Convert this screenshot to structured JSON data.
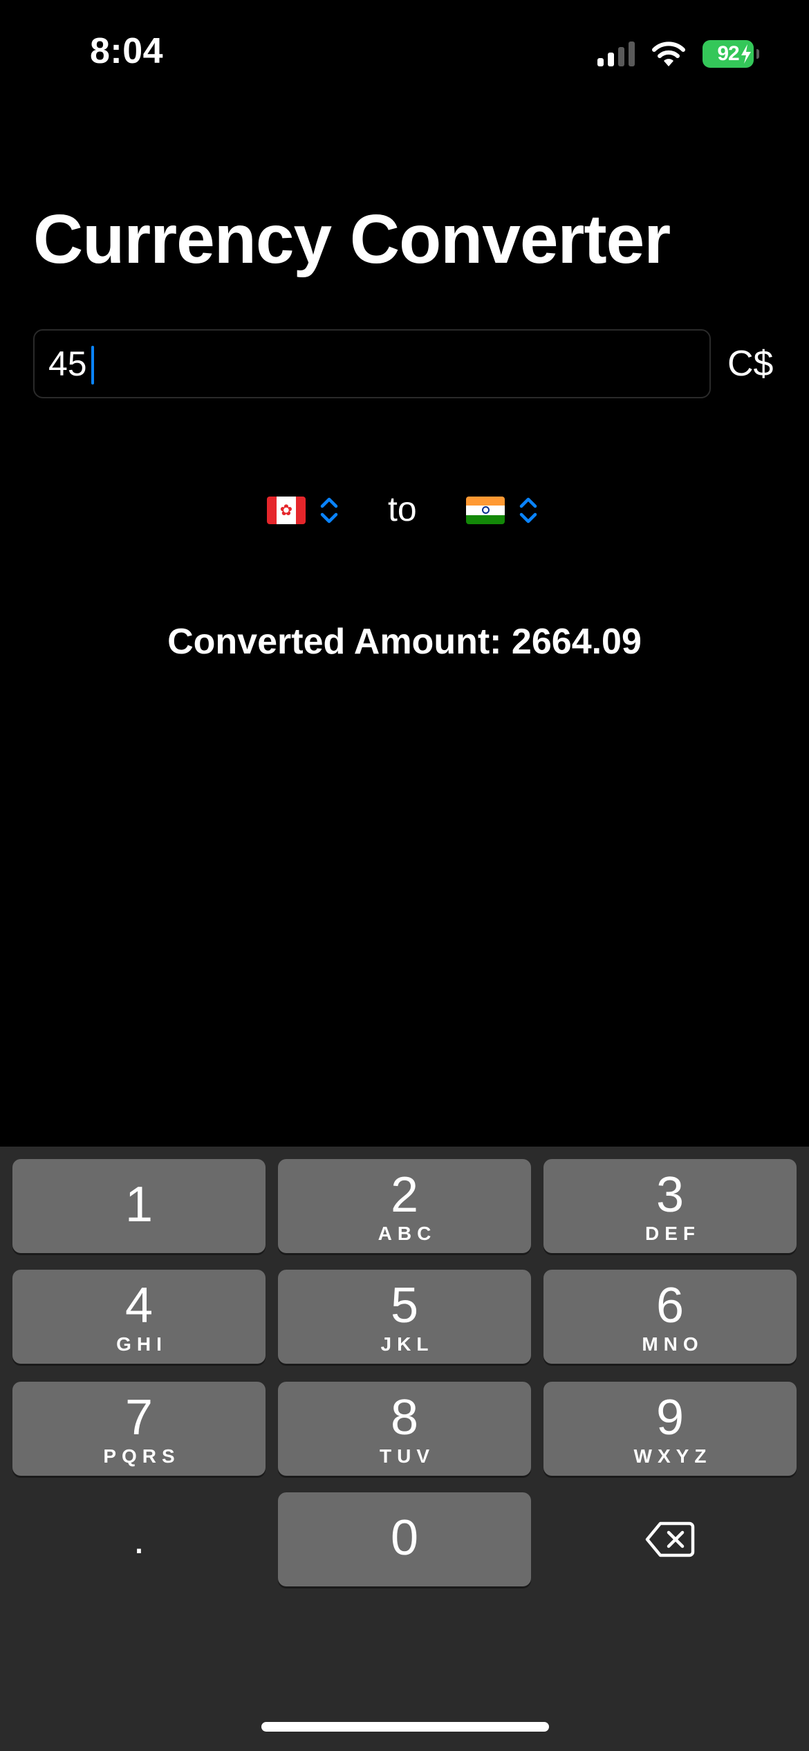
{
  "status_bar": {
    "time": "8:04",
    "battery_percent": "92",
    "signal_bars_active": 2,
    "signal_bars_total": 4
  },
  "title": "Currency Converter",
  "amount_input": {
    "value": "45",
    "currency_symbol": "C$"
  },
  "pickers": {
    "from_flag": "canada-flag-icon",
    "to_label": "to",
    "to_flag": "india-flag-icon",
    "chevron_icon": "chevron-up-down-icon"
  },
  "result_text": "Converted Amount: 2664.09",
  "keypad": {
    "keys": [
      {
        "digit": "1",
        "letters": ""
      },
      {
        "digit": "2",
        "letters": "ABC"
      },
      {
        "digit": "3",
        "letters": "DEF"
      },
      {
        "digit": "4",
        "letters": "GHI"
      },
      {
        "digit": "5",
        "letters": "JKL"
      },
      {
        "digit": "6",
        "letters": "MNO"
      },
      {
        "digit": "7",
        "letters": "PQRS"
      },
      {
        "digit": "8",
        "letters": "TUV"
      },
      {
        "digit": "9",
        "letters": "WXYZ"
      },
      {
        "digit": "0",
        "letters": ""
      }
    ],
    "decimal": ".",
    "delete_icon": "delete-backspace-icon"
  },
  "colors": {
    "background": "#000000",
    "accent": "#0a84ff",
    "battery": "#34c759",
    "keypad_background": "#2b2b2b",
    "key": "#6b6b6b"
  }
}
